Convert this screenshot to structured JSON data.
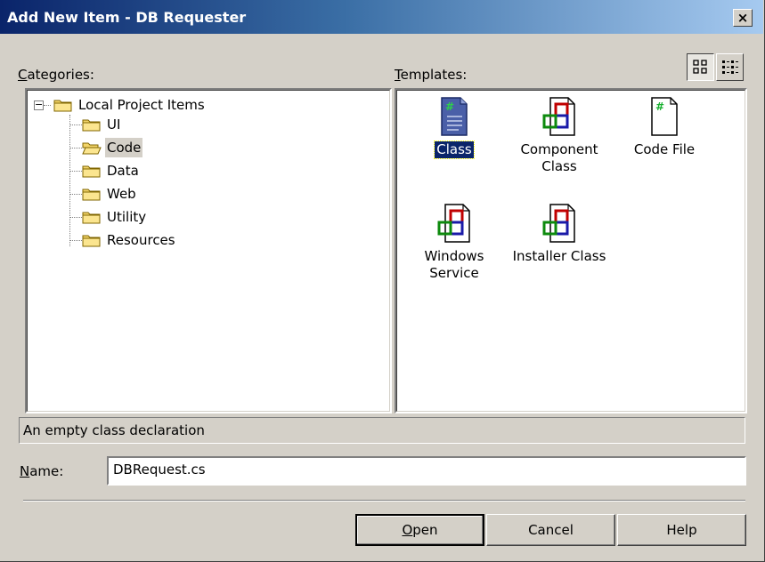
{
  "window": {
    "title": "Add New Item - DB Requester",
    "close_glyph": "×"
  },
  "categories": {
    "label": "Categories:",
    "accel": "C",
    "rest": "ategories:",
    "root": "Local Project Items",
    "items": [
      "UI",
      "Code",
      "Data",
      "Web",
      "Utility",
      "Resources"
    ],
    "selected": "Code"
  },
  "templates": {
    "label": "Templates:",
    "accel": "T",
    "rest": "emplates:",
    "items": [
      {
        "name": "Class",
        "icon": "class-icon",
        "selected": true
      },
      {
        "name": "Component\nClass",
        "icon": "component-icon"
      },
      {
        "name": "Code File",
        "icon": "code-file-icon"
      },
      {
        "name": "Windows\nService",
        "icon": "component-icon"
      },
      {
        "name": "Installer Class",
        "icon": "component-icon"
      }
    ]
  },
  "view_buttons": {
    "large_icons": "large-icons-view-icon",
    "details": "details-view-icon"
  },
  "status": {
    "text": "An empty class declaration"
  },
  "name_field": {
    "label": "Name:",
    "accel": "N",
    "rest": "ame:",
    "value": "DBRequest.cs"
  },
  "buttons": {
    "open": "Open",
    "open_accel": "O",
    "open_rest": "pen",
    "cancel": "Cancel",
    "help": "Help"
  },
  "colors": {
    "titlebar_start": "#0a246a",
    "titlebar_end": "#a6caf0",
    "face": "#d4d0c8",
    "selection": "#0a246a"
  }
}
